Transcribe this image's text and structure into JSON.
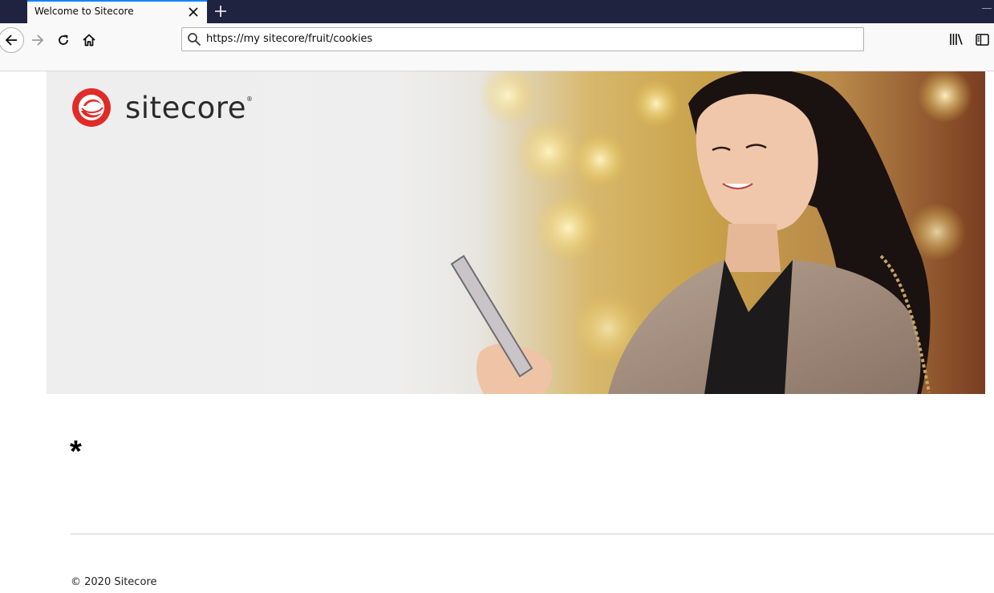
{
  "browser": {
    "tab_title": "Welcome to Sitecore",
    "url": "https://my sitecore/fruit/cookies"
  },
  "icons": {
    "tab_close": "close-icon",
    "new_tab": "plus-icon",
    "back": "arrow-left-icon",
    "forward": "arrow-right-icon",
    "reload": "reload-icon",
    "home": "home-icon",
    "search": "search-icon",
    "library": "library-icon",
    "sidebar": "sidebar-icon"
  },
  "page": {
    "logo_text": "sitecore",
    "logo_registered": "®",
    "content_heading": "*",
    "footer_text": "© 2020 Sitecore"
  },
  "colors": {
    "tabbar_bg": "#202340",
    "accent": "#0a84ff",
    "brand_red": "#e02b27"
  }
}
